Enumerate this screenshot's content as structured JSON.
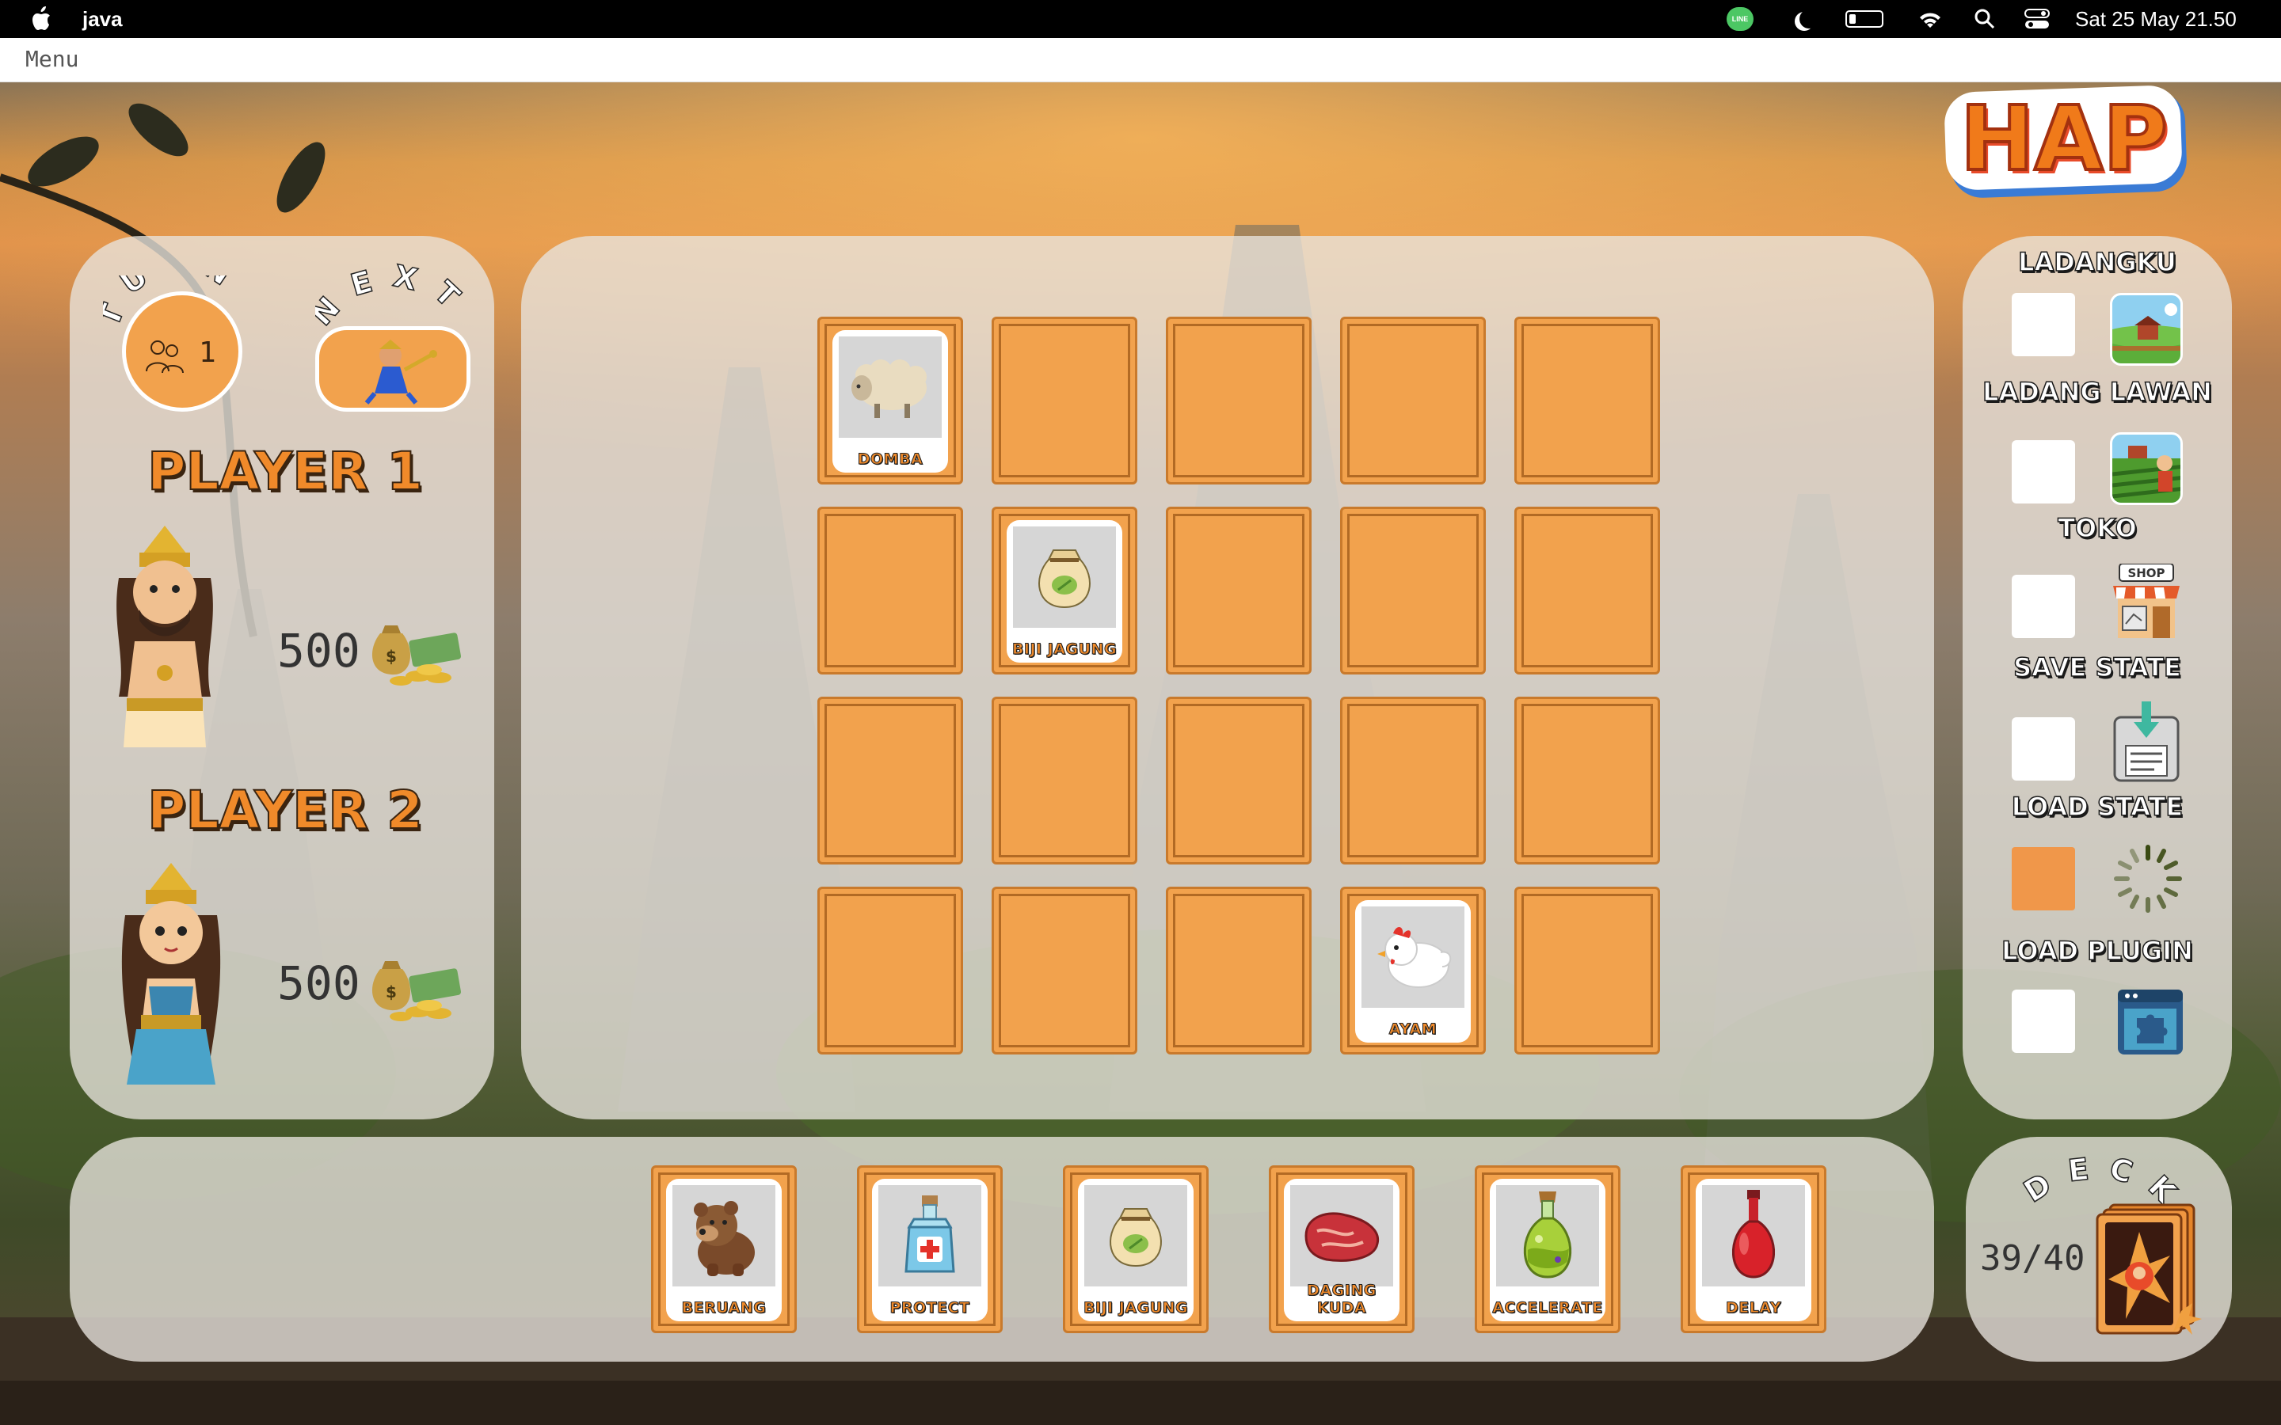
{
  "system_bar": {
    "app_name": "java",
    "datetime": "Sat 25 May  21.50",
    "line_label": "LINE"
  },
  "menubar": {
    "menu_label": "Menu"
  },
  "logo": {
    "text": "HAP"
  },
  "status": {
    "turn_label": "TURN",
    "next_label": "NEXT",
    "turn_number": "1",
    "players": [
      {
        "name": "PLAYER 1",
        "money": "500"
      },
      {
        "name": "PLAYER 2",
        "money": "500"
      }
    ]
  },
  "field": {
    "rows": 4,
    "cols": 5,
    "cards": [
      {
        "row": 0,
        "col": 0,
        "label": "DOMBA",
        "icon": "sheep-icon"
      },
      {
        "row": 1,
        "col": 1,
        "label": "BIJI JAGUNG",
        "icon": "seed-bag-icon"
      },
      {
        "row": 3,
        "col": 3,
        "label": "AYAM",
        "icon": "chicken-icon"
      }
    ]
  },
  "hand": [
    {
      "label": "BERUANG",
      "icon": "bear-icon"
    },
    {
      "label": "PROTECT",
      "icon": "potion-blue-icon"
    },
    {
      "label": "BIJI JAGUNG",
      "icon": "seed-bag-icon"
    },
    {
      "label": "DAGING KUDA",
      "icon": "meat-icon"
    },
    {
      "label": "ACCELERATE",
      "icon": "potion-green-icon"
    },
    {
      "label": "DELAY",
      "icon": "potion-red-icon"
    }
  ],
  "nav": {
    "items": [
      {
        "label": "LADANGKU",
        "icon": "farm-icon",
        "active": false
      },
      {
        "label": "LADANG LAWAN",
        "icon": "enemy-farm-icon",
        "active": false
      },
      {
        "label": "TOKO",
        "icon": "shop-icon",
        "active": false,
        "sign": "SHOP"
      },
      {
        "label": "SAVE STATE",
        "icon": "save-icon",
        "active": false
      },
      {
        "label": "LOAD STATE",
        "icon": "loading-icon",
        "active": true
      },
      {
        "label": "LOAD PLUGIN",
        "icon": "plugin-icon",
        "active": false
      }
    ]
  },
  "deck": {
    "label": "DECK",
    "count": "39/40"
  },
  "colors": {
    "accent_orange": "#f2a24d",
    "tile_border": "#c97a2c",
    "panel": "#e8e4de"
  }
}
